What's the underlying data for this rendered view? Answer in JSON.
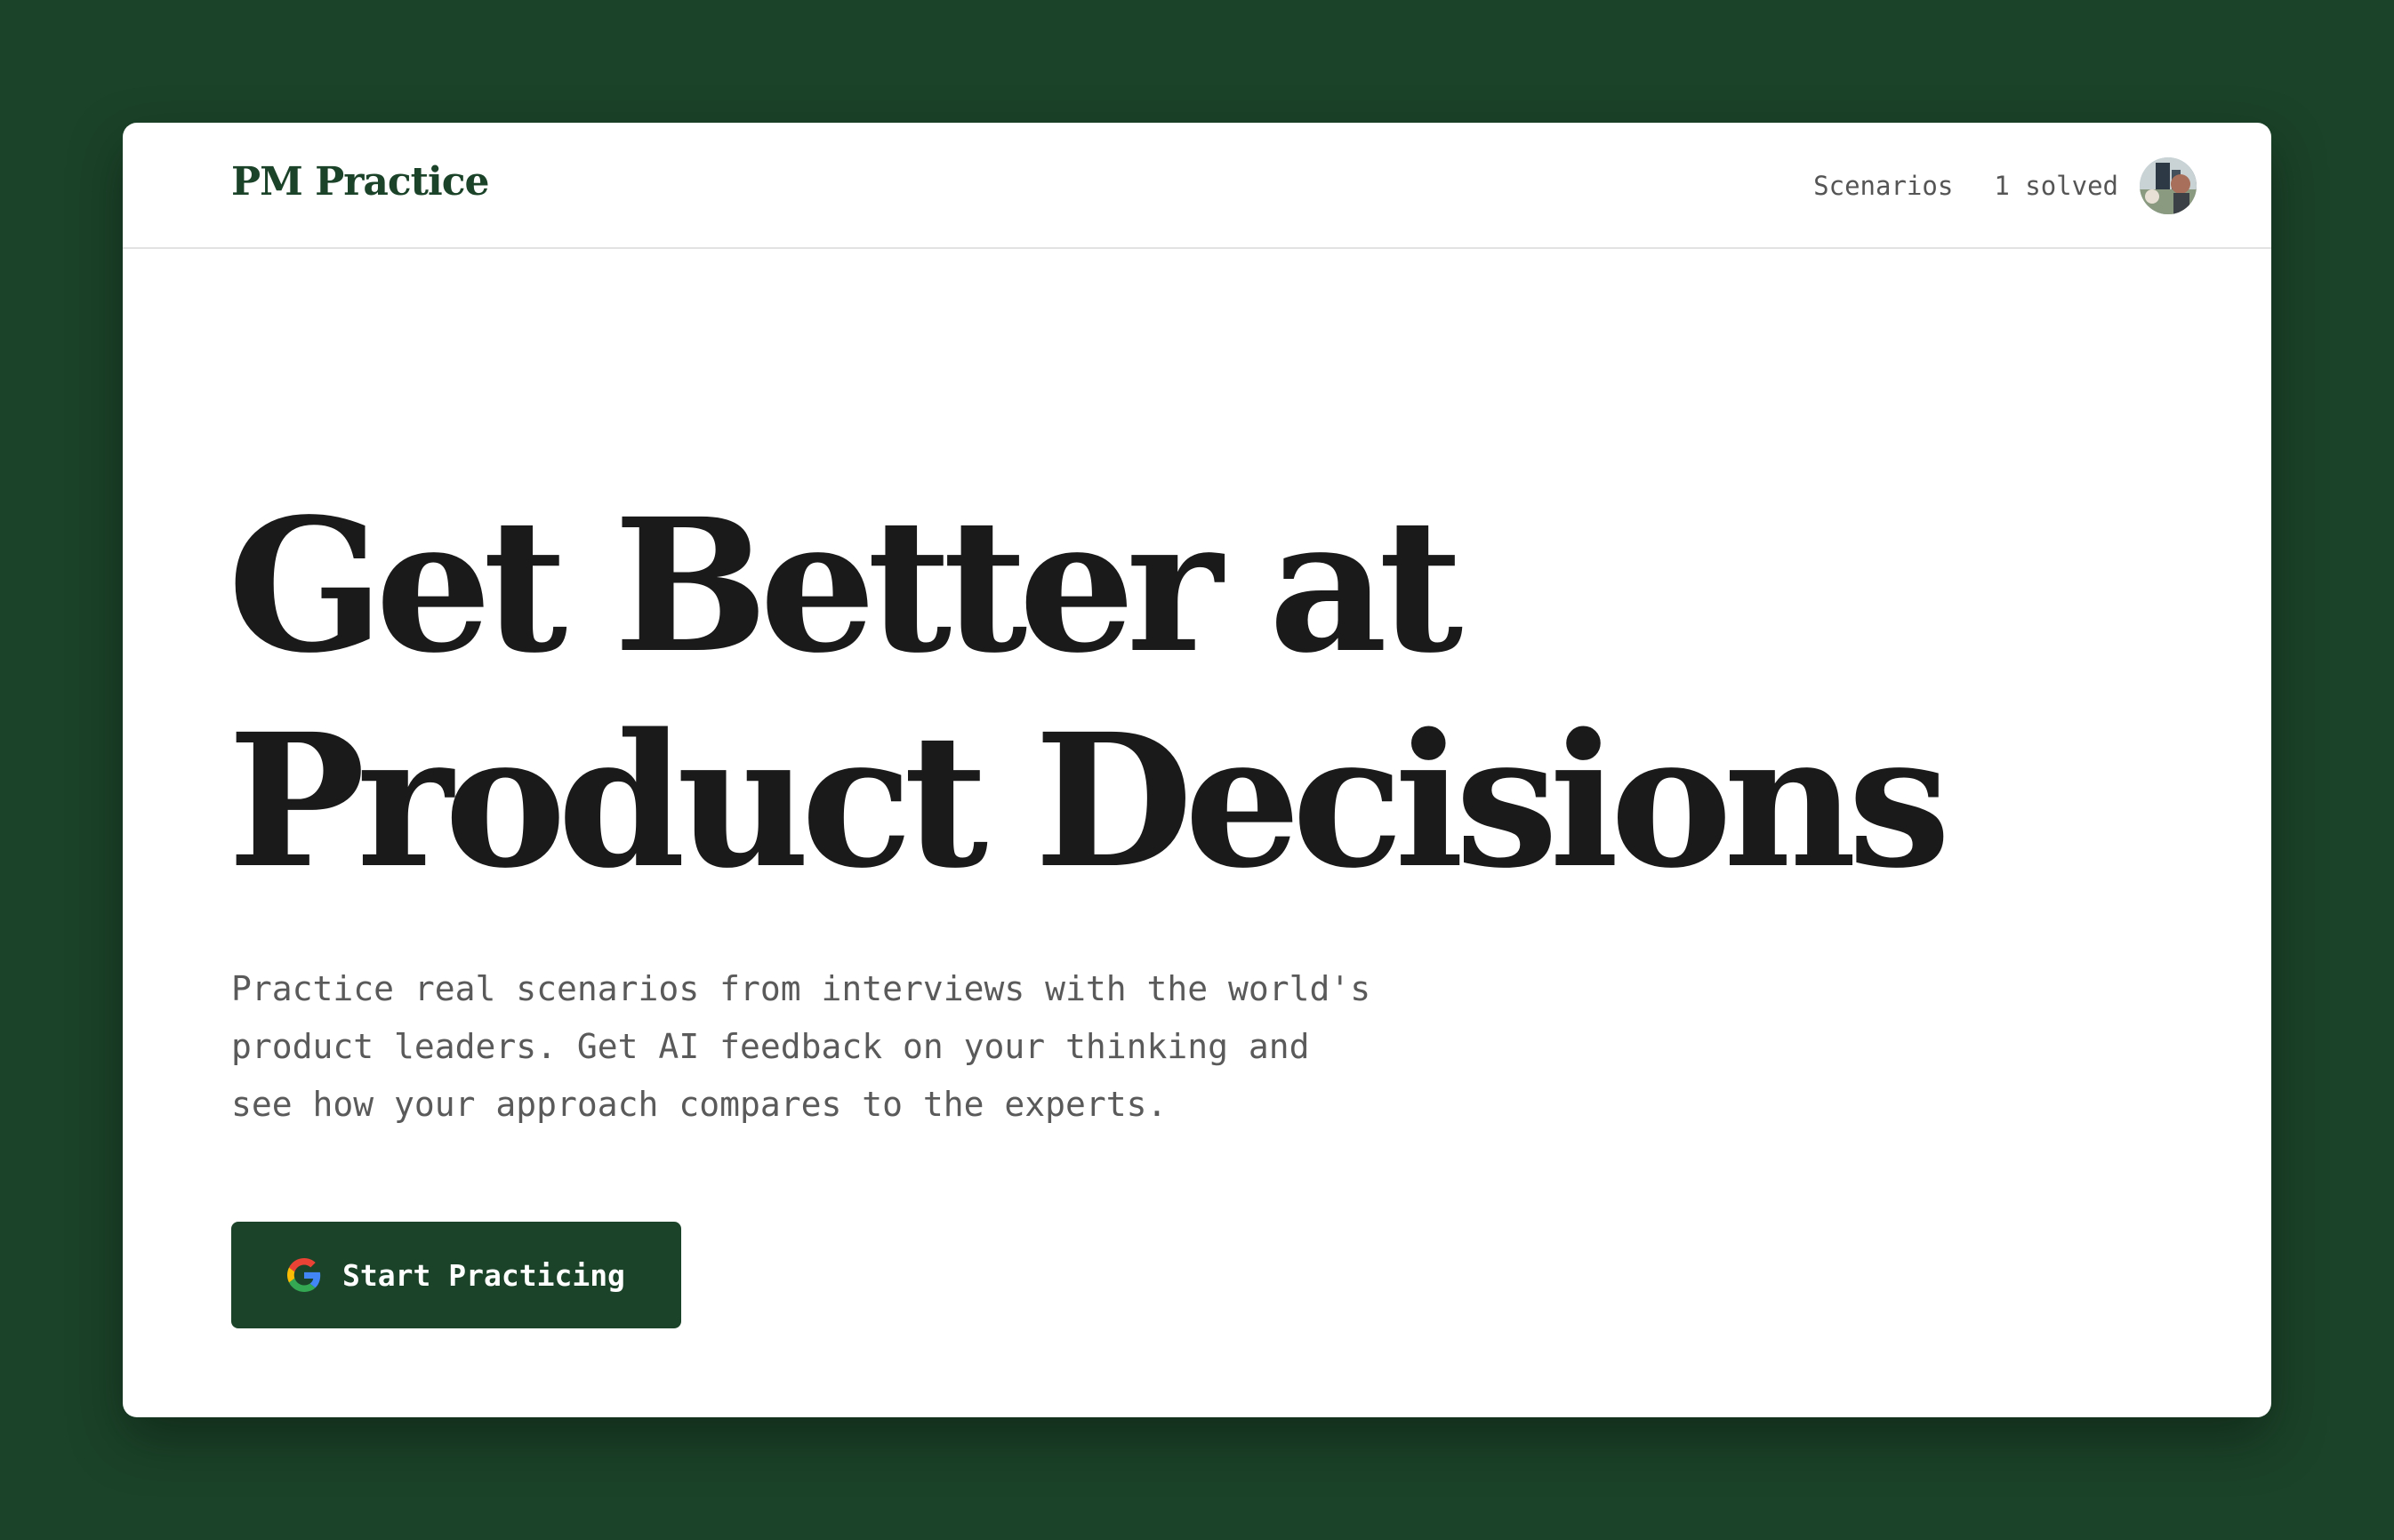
{
  "header": {
    "brand": "PM Practice",
    "nav": {
      "scenarios_label": "Scenarios",
      "solved_label": "1 solved"
    }
  },
  "hero": {
    "title_line1": "Get Better at",
    "title_line2": "Product Decisions",
    "subtitle_line1": "Practice real scenarios from interviews with the world's",
    "subtitle_line2": "product leaders. Get AI feedback on your thinking and",
    "subtitle_line3": "see how your approach compares to the experts.",
    "cta": {
      "label": "Start Practicing",
      "icon": "google-icon"
    }
  },
  "colors": {
    "background": "#1b4329",
    "brand": "#1b4329",
    "text": "#1a1a1a",
    "muted": "#5a5a5a",
    "button": "#1b4329"
  }
}
